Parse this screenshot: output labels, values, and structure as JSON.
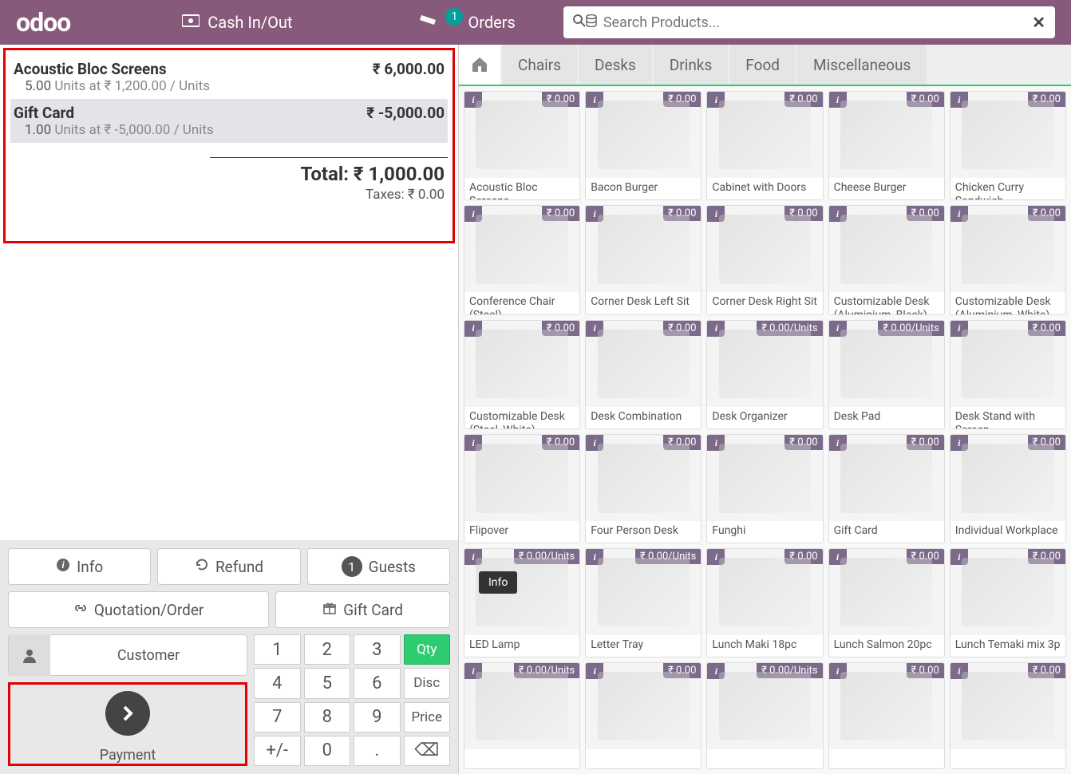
{
  "header": {
    "logo": "odoo",
    "cash_label": "Cash In/Out",
    "orders_label": "Orders",
    "orders_badge": "1",
    "search_placeholder": "Search Products..."
  },
  "order": {
    "lines": [
      {
        "name": "Acoustic Bloc Screens",
        "qty": "5.00",
        "unit_text": "Units at ₹ 1,200.00 / Units",
        "price": "₹ 6,000.00",
        "selected": false
      },
      {
        "name": "Gift Card",
        "qty": "1.00",
        "unit_text": "Units at ₹ -5,000.00 / Units",
        "price": "₹ -5,000.00",
        "selected": true
      }
    ],
    "total_label": "Total: ₹ 1,000.00",
    "taxes_label": "Taxes: ₹ 0.00"
  },
  "controls": {
    "info": "Info",
    "refund": "Refund",
    "guests": "Guests",
    "guests_count": "1",
    "quotation": "Quotation/Order",
    "giftcard": "Gift Card",
    "customer": "Customer",
    "payment": "Payment"
  },
  "numpad": {
    "keys": [
      "1",
      "2",
      "3",
      "Qty",
      "4",
      "5",
      "6",
      "Disc",
      "7",
      "8",
      "9",
      "Price",
      "+/-",
      "0",
      ".",
      "⌫"
    ],
    "active_mode": "Qty"
  },
  "categories": [
    "Chairs",
    "Desks",
    "Drinks",
    "Food",
    "Miscellaneous"
  ],
  "products": [
    {
      "name": "Acoustic Bloc Screens",
      "price": "₹ 0.00"
    },
    {
      "name": "Bacon Burger",
      "price": "₹ 0.00"
    },
    {
      "name": "Cabinet with Doors",
      "price": "₹ 0.00"
    },
    {
      "name": "Cheese Burger",
      "price": "₹ 0.00"
    },
    {
      "name": "Chicken Curry Sandwich",
      "price": "₹ 0.00"
    },
    {
      "name": "Conference Chair (Steel)",
      "price": "₹ 0.00"
    },
    {
      "name": "Corner Desk Left Sit",
      "price": "₹ 0.00"
    },
    {
      "name": "Corner Desk Right Sit",
      "price": "₹ 0.00"
    },
    {
      "name": "Customizable Desk (Aluminium, Black)",
      "price": "₹ 0.00"
    },
    {
      "name": "Customizable Desk (Aluminium, White)",
      "price": "₹ 0.00"
    },
    {
      "name": "Customizable Desk (Steel, White)",
      "price": "₹ 0.00"
    },
    {
      "name": "Desk Combination",
      "price": "₹ 0.00"
    },
    {
      "name": "Desk Organizer",
      "price": "₹ 0.00/Units"
    },
    {
      "name": "Desk Pad",
      "price": "₹ 0.00/Units"
    },
    {
      "name": "Desk Stand with Screen",
      "price": "₹ 0.00"
    },
    {
      "name": "Flipover",
      "price": "₹ 0.00"
    },
    {
      "name": "Four Person Desk",
      "price": "₹ 0.00"
    },
    {
      "name": "Funghi",
      "price": "₹ 0.00"
    },
    {
      "name": "Gift Card",
      "price": "₹ 0.00"
    },
    {
      "name": "Individual Workplace",
      "price": "₹ 0.00"
    },
    {
      "name": "LED Lamp",
      "price": "₹ 0.00/Units",
      "tooltip": "Info"
    },
    {
      "name": "Letter Tray",
      "price": "₹ 0.00/Units"
    },
    {
      "name": "Lunch Maki 18pc",
      "price": "₹ 0.00"
    },
    {
      "name": "Lunch Salmon 20pc",
      "price": "₹ 0.00"
    },
    {
      "name": "Lunch Temaki mix 3p",
      "price": "₹ 0.00"
    },
    {
      "name": "",
      "price": "₹ 0.00/Units"
    },
    {
      "name": "",
      "price": "₹ 0.00"
    },
    {
      "name": "",
      "price": "₹ 0.00/Units"
    },
    {
      "name": "",
      "price": "₹ 0.00"
    },
    {
      "name": "",
      "price": "₹ 0.00"
    }
  ]
}
